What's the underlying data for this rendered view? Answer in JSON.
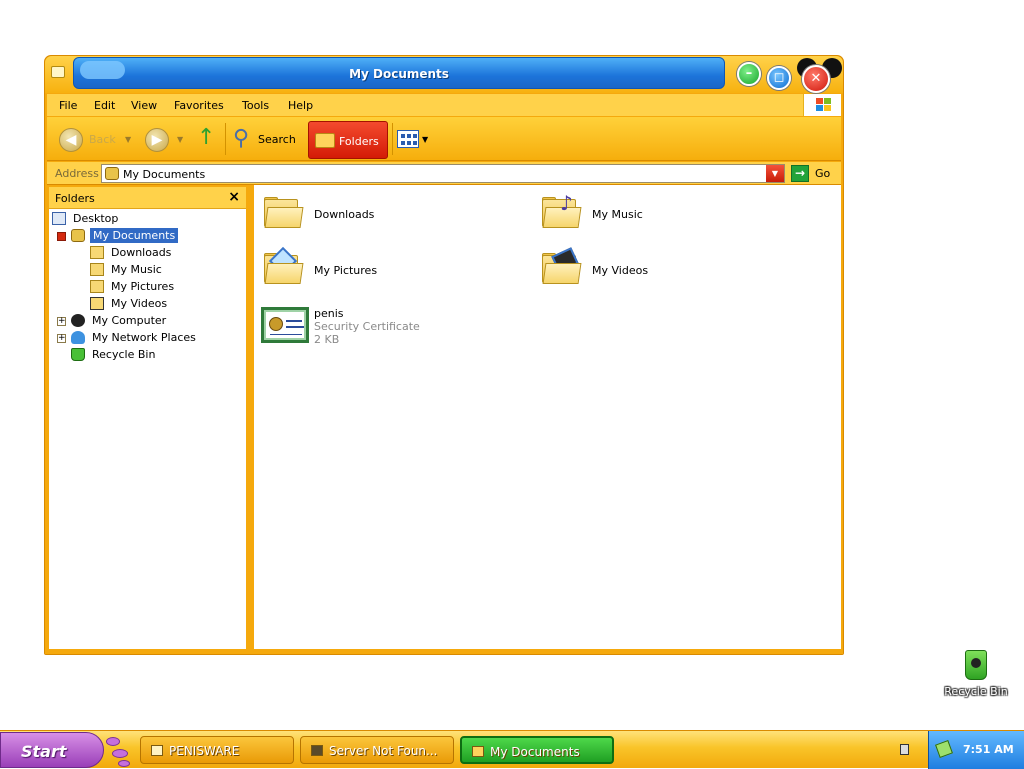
{
  "window": {
    "title": "My Documents",
    "menu": [
      "File",
      "Edit",
      "View",
      "Favorites",
      "Tools",
      "Help"
    ],
    "toolbar": {
      "back_label": "Back",
      "search_label": "Search",
      "folders_label": "Folders"
    },
    "address": {
      "label": "Address",
      "value": "My Documents",
      "go_label": "Go"
    }
  },
  "folders_pane": {
    "title": "Folders",
    "close_glyph": "×",
    "items": [
      {
        "label": "Desktop"
      },
      {
        "label": "My Documents"
      },
      {
        "label": "Downloads"
      },
      {
        "label": "My Music"
      },
      {
        "label": "My Pictures"
      },
      {
        "label": "My Videos"
      },
      {
        "label": "My Computer"
      },
      {
        "label": "My Network Places"
      },
      {
        "label": "Recycle Bin"
      }
    ]
  },
  "files": [
    {
      "name": "Downloads"
    },
    {
      "name": "My Music"
    },
    {
      "name": "My Pictures"
    },
    {
      "name": "My Videos"
    },
    {
      "name": "penis",
      "type": "Security Certificate",
      "size": "2 KB"
    }
  ],
  "desktop": {
    "recycle_bin_label": "Recycle Bin"
  },
  "taskbar": {
    "start_label": "Start",
    "tasks": [
      {
        "label": "PENISWARE",
        "active": false
      },
      {
        "label": "Server Not Foun...",
        "active": false
      },
      {
        "label": "My Documents",
        "active": true
      }
    ],
    "clock": "7:51 AM"
  },
  "colors": {
    "theme_orange": "#f5a90d",
    "title_blue": "#1c74da",
    "selection_blue": "#316ac5",
    "folders_button_red": "#d41b06",
    "active_task_green": "#1f9f23",
    "start_purple": "#9a3fb8"
  }
}
